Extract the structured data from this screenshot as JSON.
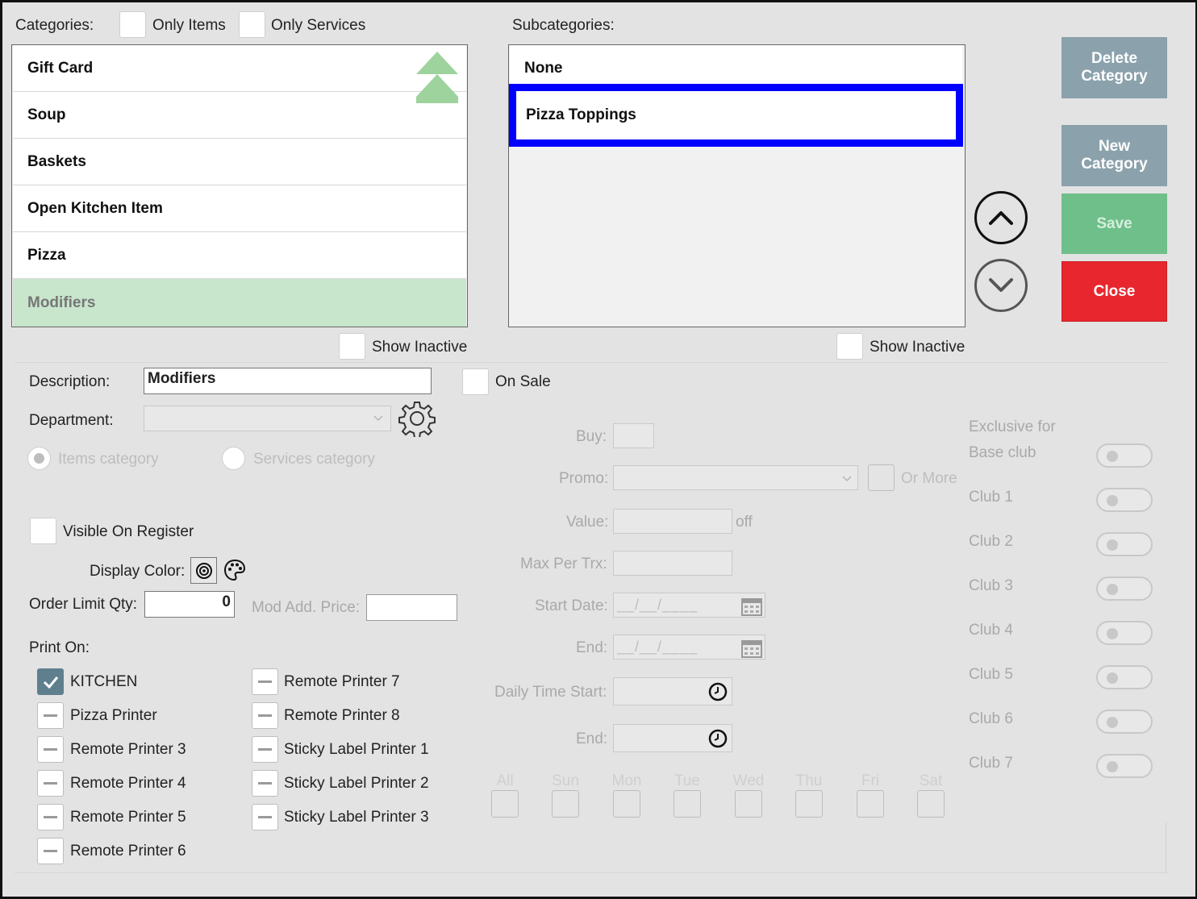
{
  "header": {
    "categories_label": "Categories:",
    "only_items_label": "Only Items",
    "only_services_label": "Only Services",
    "subcategories_label": "Subcategories:"
  },
  "categories": [
    {
      "label": "Gift Card"
    },
    {
      "label": "Soup"
    },
    {
      "label": "Baskets"
    },
    {
      "label": "Open Kitchen Item"
    },
    {
      "label": "Pizza"
    },
    {
      "label": "Modifiers",
      "selected": true
    }
  ],
  "subcategories": [
    {
      "label": "None"
    },
    {
      "label": "Pizza Toppings",
      "selected": true
    }
  ],
  "show_inactive_label": "Show Inactive",
  "buttons": {
    "delete_category": "Delete Category",
    "new_category": "New Category",
    "save": "Save",
    "close": "Close"
  },
  "form": {
    "description_label": "Description:",
    "description_value": "Modifiers",
    "on_sale_label": "On Sale",
    "department_label": "Department:",
    "items_category_label": "Items category",
    "services_category_label": "Services category",
    "visible_on_register_label": "Visible On Register",
    "display_color_label": "Display Color:",
    "order_limit_label": "Order Limit Qty:",
    "order_limit_value": "0",
    "mod_add_price_label": "Mod Add. Price:",
    "print_on_label": "Print On:"
  },
  "printers_left": [
    {
      "label": "KITCHEN",
      "checked": true
    },
    {
      "label": "Pizza Printer",
      "checked": false
    },
    {
      "label": "Remote Printer 3",
      "checked": false
    },
    {
      "label": "Remote Printer 4",
      "checked": false
    },
    {
      "label": "Remote Printer 5",
      "checked": false
    },
    {
      "label": "Remote Printer 6",
      "checked": false
    }
  ],
  "printers_right": [
    {
      "label": "Remote Printer 7",
      "checked": false
    },
    {
      "label": "Remote Printer 8",
      "checked": false
    },
    {
      "label": "Sticky Label Printer 1",
      "checked": false
    },
    {
      "label": "Sticky Label Printer 2",
      "checked": false
    },
    {
      "label": "Sticky Label Printer 3",
      "checked": false
    }
  ],
  "promo": {
    "buy_label": "Buy:",
    "promo_label": "Promo:",
    "or_more_label": "Or More",
    "value_label": "Value:",
    "off_label": "off",
    "max_per_trx_label": "Max Per Trx:",
    "start_date_label": "Start Date:",
    "start_date_placeholder": "__/__/____",
    "end_label": "End:",
    "end_date_placeholder": "__/__/____",
    "daily_time_start_label": "Daily Time Start:",
    "daily_end_label": "End:",
    "days": [
      "All",
      "Sun",
      "Mon",
      "Tue",
      "Wed",
      "Thu",
      "Fri",
      "Sat"
    ]
  },
  "clubs": {
    "exclusive_label": "Exclusive for",
    "items": [
      "Base club",
      "Club 1",
      "Club 2",
      "Club 3",
      "Club 4",
      "Club 5",
      "Club 6",
      "Club 7"
    ]
  },
  "colors": {
    "selected_row": "#c8e6cc",
    "selection_border": "#0000ff",
    "btn_gray": "#8ba2ad",
    "btn_save": "#6fbf8a",
    "btn_close": "#e8262d",
    "check_on": "#5f7f8f"
  }
}
